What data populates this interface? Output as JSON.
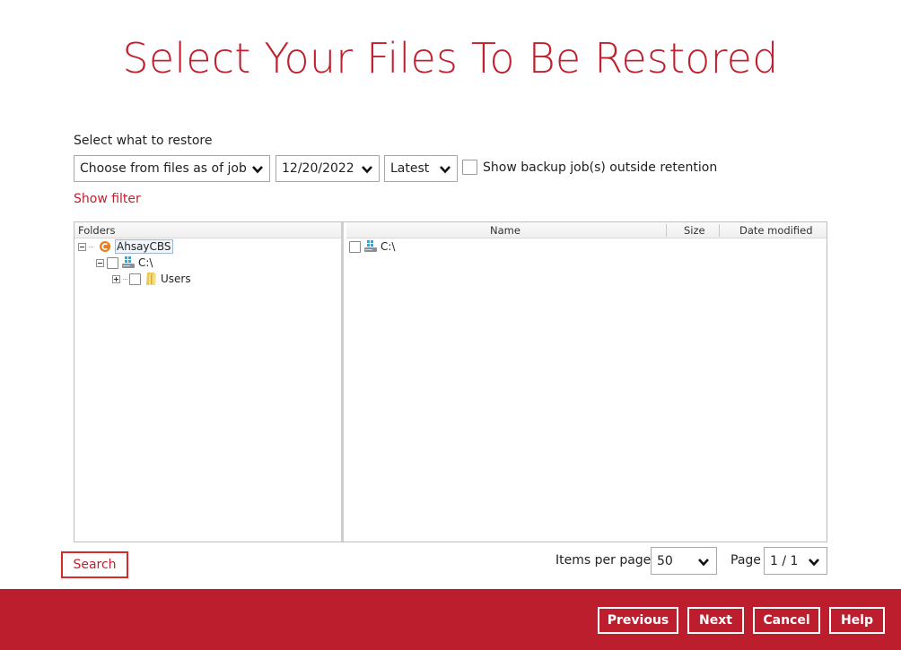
{
  "page": {
    "title": "Select Your Files To Be Restored",
    "select_label": "Select what to restore",
    "show_filter": "Show filter"
  },
  "controls": {
    "restore_mode": "Choose from files as of job",
    "date": "12/20/2022",
    "version": "Latest",
    "retention_label": "Show backup job(s) outside retention"
  },
  "folders": {
    "header": "Folders",
    "tree": [
      {
        "label": "AhsayCBS",
        "icon": "backup-set-icon"
      },
      {
        "label": "C:\\",
        "icon": "drive-icon"
      },
      {
        "label": "Users",
        "icon": "folder-icon"
      }
    ]
  },
  "files": {
    "columns": {
      "name": "Name",
      "size": "Size",
      "date_modified": "Date modified"
    },
    "rows": [
      {
        "name": "C:\\",
        "icon": "drive-icon"
      }
    ]
  },
  "pagination": {
    "items_per_page_label": "Items per page",
    "items_per_page": "50",
    "page_label": "Page",
    "page_value": "1 / 1"
  },
  "actions": {
    "search": "Search",
    "previous": "Previous",
    "next": "Next",
    "cancel": "Cancel",
    "help": "Help"
  },
  "colors": {
    "accent": "#c0202f",
    "bottom_bar": "#bc1e2d"
  }
}
